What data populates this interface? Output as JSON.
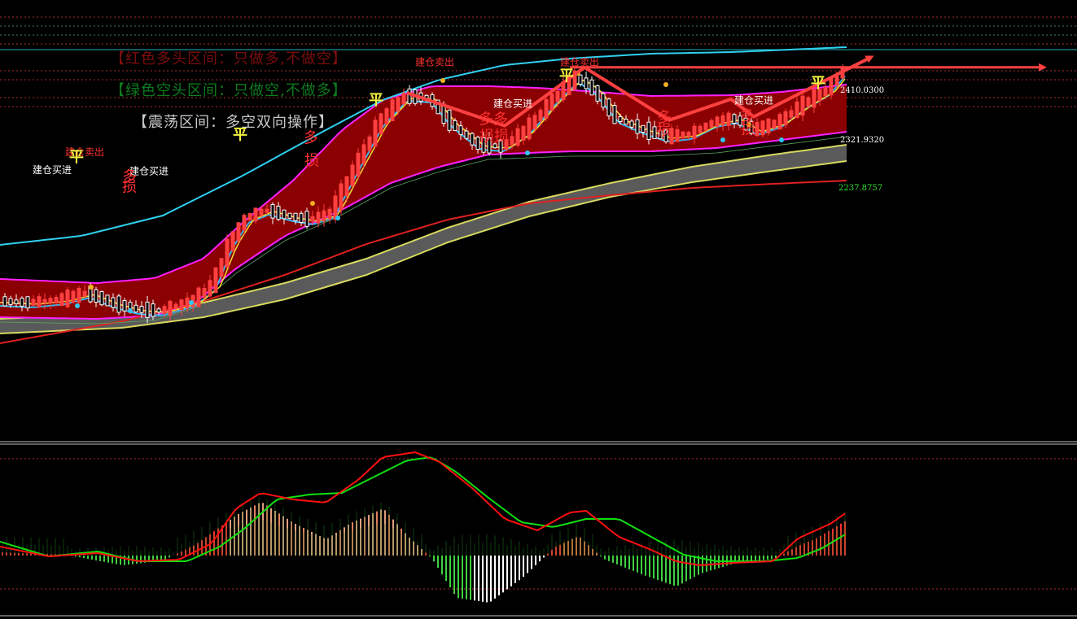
{
  "legend": {
    "red_zone": "【红色多头区间：只做多,不做空】",
    "green_zone": "【绿色空头区间：只做空,不做多】",
    "range_zone": "【震荡区间：多空双向操作】"
  },
  "colors": {
    "background": "#000000",
    "band_fill": "#8b0000",
    "band_border": "#ff20ff",
    "ribbon_fill": "#5a5a5a",
    "ribbon_edge": "#d8d860",
    "ma_cyan": "#30d0f0",
    "ma_red": "#e02020",
    "arrow": "#ff4040",
    "candle_up": "#ff4040",
    "candle_down": "#ffffff",
    "macd_dif": "#ff1010",
    "macd_dea": "#10e010"
  },
  "chart_data": [
    {
      "type": "line",
      "name": "main-price-chart",
      "price_axis_labels": [
        "2410.0300",
        "2321.9320",
        "2237.8757"
      ],
      "price_axis_values": [
        2410.03,
        2321.932,
        2237.8757
      ],
      "annotations": [
        {
          "text": "建仓卖出",
          "kind": "sell-label",
          "x": 104,
          "y": 2294
        },
        {
          "text": "建仓买进",
          "kind": "buy-label",
          "x": 64,
          "y": 2262
        },
        {
          "text": "建仓买进",
          "kind": "buy-label",
          "x": 183,
          "y": 2260
        },
        {
          "text": "建仓卖出",
          "kind": "sell-label",
          "x": 534,
          "y": 2452
        },
        {
          "text": "建仓买进",
          "kind": "buy-label",
          "x": 630,
          "y": 2379
        },
        {
          "text": "建仓卖出",
          "kind": "sell-label",
          "x": 712,
          "y": 2452
        },
        {
          "text": "建仓买进",
          "kind": "buy-label",
          "x": 926,
          "y": 2385
        },
        {
          "text": "平",
          "kind": "close-marker",
          "x": 94,
          "y": 2282
        },
        {
          "text": "平",
          "kind": "close-marker",
          "x": 295,
          "y": 2322
        },
        {
          "text": "平",
          "kind": "close-marker",
          "x": 462,
          "y": 2383
        },
        {
          "text": "平",
          "kind": "close-marker",
          "x": 696,
          "y": 2426
        },
        {
          "text": "平",
          "kind": "close-marker",
          "x": 1005,
          "y": 2413
        },
        {
          "text": "多",
          "kind": "long-marker",
          "x": 159,
          "y": 2248
        },
        {
          "text": "多",
          "kind": "long-marker",
          "x": 382,
          "y": 2316
        },
        {
          "text": "多多",
          "kind": "long-marker",
          "x": 606,
          "y": 2349
        },
        {
          "text": "多",
          "kind": "long-marker",
          "x": 816,
          "y": 2352
        },
        {
          "text": "多",
          "kind": "long-marker",
          "x": 918,
          "y": 2355
        },
        {
          "text": "损",
          "kind": "stop-marker",
          "x": 159,
          "y": 2230
        },
        {
          "text": "损",
          "kind": "stop-marker",
          "x": 383,
          "y": 2276
        },
        {
          "text": "损损",
          "kind": "stop-marker",
          "x": 607,
          "y": 2319
        },
        {
          "text": "损",
          "kind": "stop-marker",
          "x": 816,
          "y": 2329
        },
        {
          "text": "损",
          "kind": "stop-marker",
          "x": 919,
          "y": 2332
        }
      ],
      "zigzag_arrow_path": [
        [
          500,
          2404
        ],
        [
          620,
          2346
        ],
        [
          718,
          2449
        ],
        [
          822,
          2356
        ],
        [
          898,
          2393
        ],
        [
          926,
          2362
        ],
        [
          1070,
          2467
        ]
      ],
      "horizontal_arrow": {
        "from_x": 700,
        "to_x": 1282,
        "y": 2449
      }
    },
    {
      "type": "bar",
      "name": "macd-indicator",
      "series": []
    }
  ]
}
